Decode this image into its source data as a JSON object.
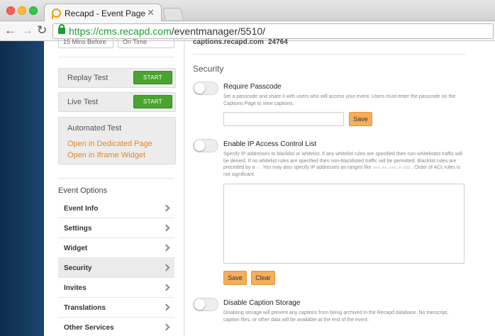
{
  "browser": {
    "tab_title": "Recapd - Event Page",
    "tab_close": "✕",
    "url_scheme": "https://",
    "url_host": "cms.recapd.com",
    "url_path": "/eventmanager/5510/"
  },
  "sidebar": {
    "select_1": "15 Mins Before",
    "select_2": "On Time",
    "replay_test_label": "Replay Test",
    "live_test_label": "Live Test",
    "start_label": "START",
    "automated_test": {
      "title": "Automated Test",
      "link_dedicated": "Open in Dedicated Page",
      "link_iframe": "Open in Iframe Widget"
    },
    "event_options_heading": "Event Options",
    "options": [
      {
        "label": "Event Info"
      },
      {
        "label": "Settings"
      },
      {
        "label": "Widget"
      },
      {
        "label": "Security",
        "active": true
      },
      {
        "label": "Invites"
      },
      {
        "label": "Translations"
      },
      {
        "label": "Other Services"
      }
    ]
  },
  "main": {
    "caption_domain": "captions.recapd.com",
    "caption_port": "24764",
    "section_title": "Security",
    "passcode": {
      "title": "Require Passcode",
      "description": "Set a passcode and share it with users who will access your event. Users must enter the passcode on the Captions Page to view captions.",
      "save_label": "Save"
    },
    "acl": {
      "title": "Enable IP Access Control List",
      "description_1": "Specify IP addresses to blacklist or whitelist. If any whitelist rules are specified then non-whitelisted traffic will be denied. If no whitelist rules are specified then non-blacklisted traffic will be permitted. Blacklist rules are preceded by a",
      "code_1": "!",
      "description_2": ". You may also specify IP addresses as ranges like",
      "code_2": "xxx.xx.xxx.0-255",
      "description_3": ". Order of ACL rules is not significant.",
      "save_label": "Save",
      "clear_label": "Clear"
    },
    "storage": {
      "title": "Disable Caption Storage",
      "description": "Disabling storage will prevent any captions from being archived in the Recapd database. No transcript, caption files, or other data will be available at the end of the event."
    }
  },
  "icons": {
    "back": "←",
    "forward": "→",
    "reload": "↻"
  },
  "colors": {
    "accent_orange": "#f5ae5a",
    "link_orange": "#e0872c",
    "start_green": "#4aa32f",
    "secure_green": "#1d9e2c",
    "sidebar_blue": "#1a4670"
  }
}
